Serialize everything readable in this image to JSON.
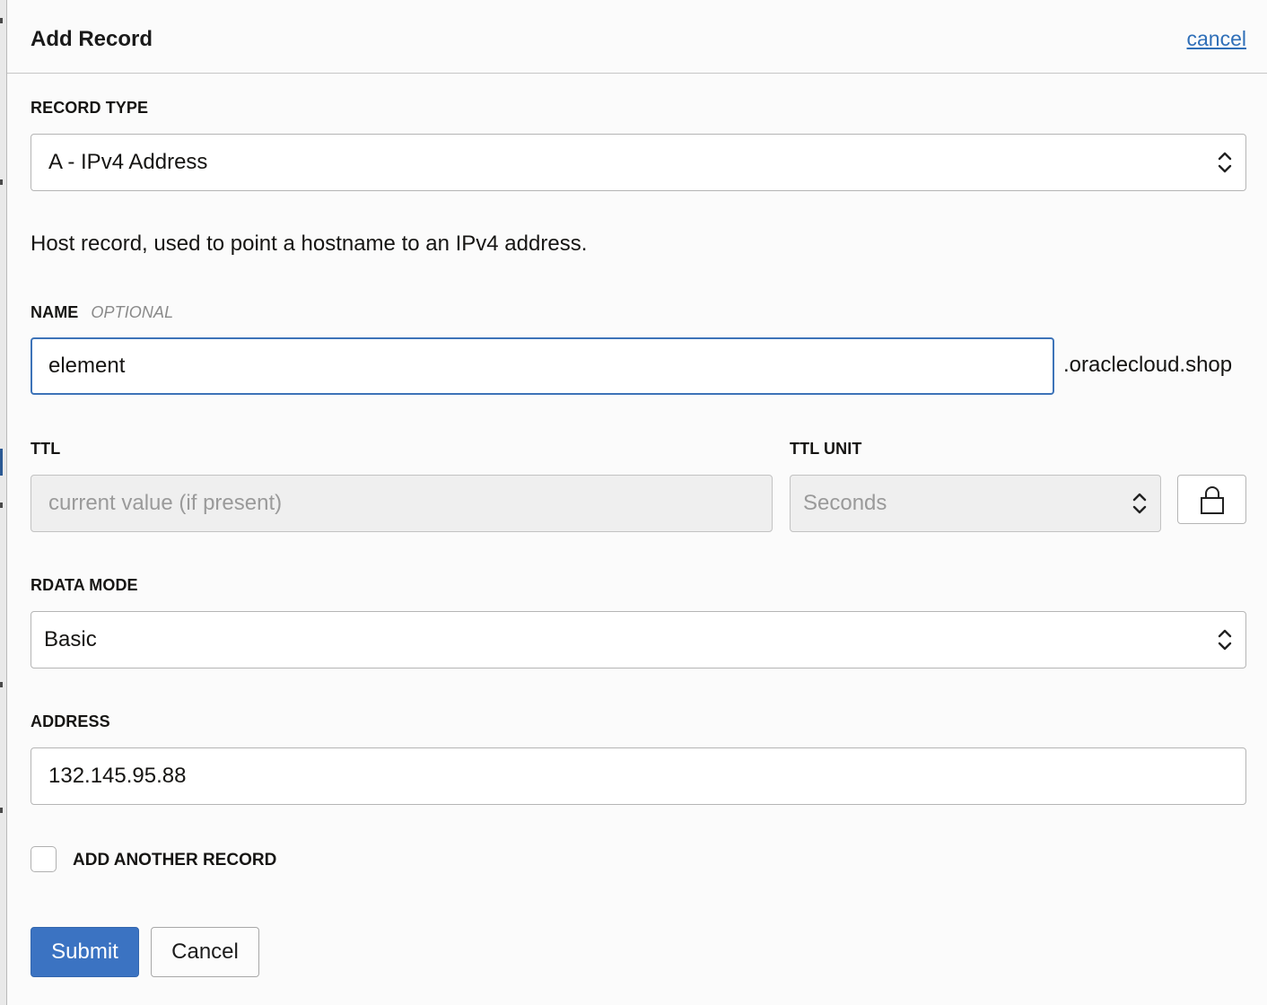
{
  "dialog": {
    "title": "Add Record",
    "close_link": "cancel"
  },
  "record_type": {
    "label": "RECORD TYPE",
    "value": "A - IPv4 Address",
    "help": "Host record, used to point a hostname to an IPv4 address."
  },
  "name": {
    "label": "NAME",
    "optional": "OPTIONAL",
    "value": "element",
    "suffix": ".oraclecloud.shop"
  },
  "ttl": {
    "label": "TTL",
    "placeholder": "current value (if present)",
    "unit_label": "TTL UNIT",
    "unit_value": "Seconds"
  },
  "rdata": {
    "label": "RDATA MODE",
    "value": "Basic"
  },
  "address": {
    "label": "ADDRESS",
    "value": "132.145.95.88"
  },
  "add_another": {
    "label": "ADD ANOTHER RECORD",
    "checked": false
  },
  "actions": {
    "submit": "Submit",
    "cancel": "Cancel"
  },
  "colors": {
    "primary": "#3b73c2",
    "link": "#2f6fb8",
    "focus_border": "#3d73b8"
  }
}
